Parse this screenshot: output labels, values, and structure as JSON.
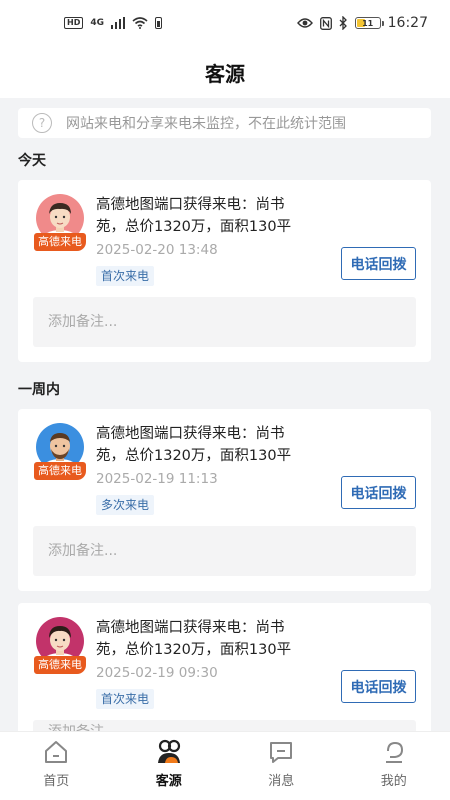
{
  "status_bar": {
    "hd": "HD",
    "network": "4G",
    "battery_level": "11",
    "time": "16:27"
  },
  "header": {
    "title": "客源"
  },
  "notice": {
    "icon": "question-circle-icon",
    "text": "网站来电和分享来电未监控，不在此统计范围"
  },
  "sections": {
    "today": "今天",
    "week": "一周内"
  },
  "cards": [
    {
      "source_badge": "高德来电",
      "title": "高德地图端口获得来电：尚书苑，总价1320万，面积130平",
      "time": "2025-02-20 13:48",
      "tag": "首次来电",
      "call_label": "电话回拨",
      "note_placeholder": "添加备注...",
      "avatar_color": "#f08a8a"
    },
    {
      "source_badge": "高德来电",
      "title": "高德地图端口获得来电：尚书苑，总价1320万，面积130平",
      "time": "2025-02-19 11:13",
      "tag": "多次来电",
      "call_label": "电话回拨",
      "note_placeholder": "添加备注...",
      "avatar_color": "#3b8fe0"
    },
    {
      "source_badge": "高德来电",
      "title": "高德地图端口获得来电：尚书苑，总价1320万，面积130平",
      "time": "2025-02-19 09:30",
      "tag": "首次来电",
      "call_label": "电话回拨",
      "note_placeholder": "添加备注...",
      "avatar_color": "#c2336a"
    }
  ],
  "tabbar": {
    "active": "客源",
    "items": [
      {
        "label": "首页",
        "icon": "home-icon"
      },
      {
        "label": "客源",
        "icon": "clients-icon"
      },
      {
        "label": "消息",
        "icon": "message-icon"
      },
      {
        "label": "我的",
        "icon": "profile-icon"
      }
    ]
  },
  "colors": {
    "accent": "#2f6bb5",
    "badge": "#e85a1e",
    "tag_bg": "#eef4fb"
  }
}
